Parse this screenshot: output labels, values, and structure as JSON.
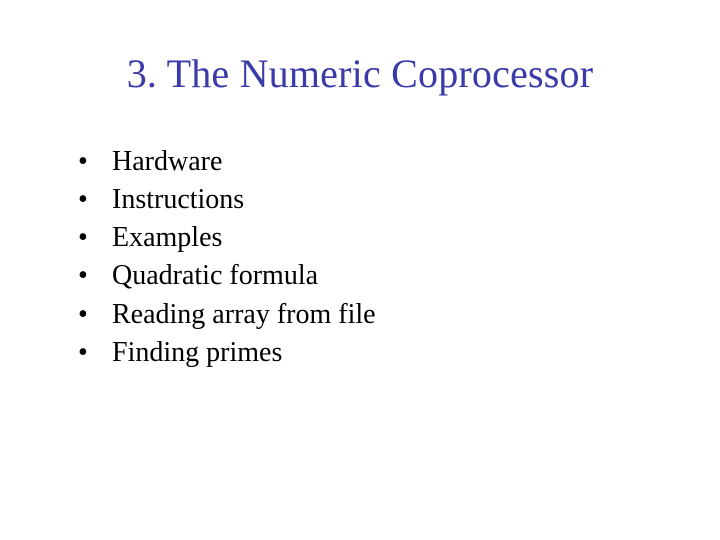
{
  "title": "3. The Numeric Coprocessor",
  "bullets": {
    "items": [
      {
        "text": "Hardware"
      },
      {
        "text": "Instructions"
      },
      {
        "text": "Examples"
      },
      {
        "text": "Quadratic formula"
      },
      {
        "text": "Reading array from file"
      },
      {
        "text": "Finding primes"
      }
    ]
  },
  "glyph": {
    "dot": "•"
  }
}
